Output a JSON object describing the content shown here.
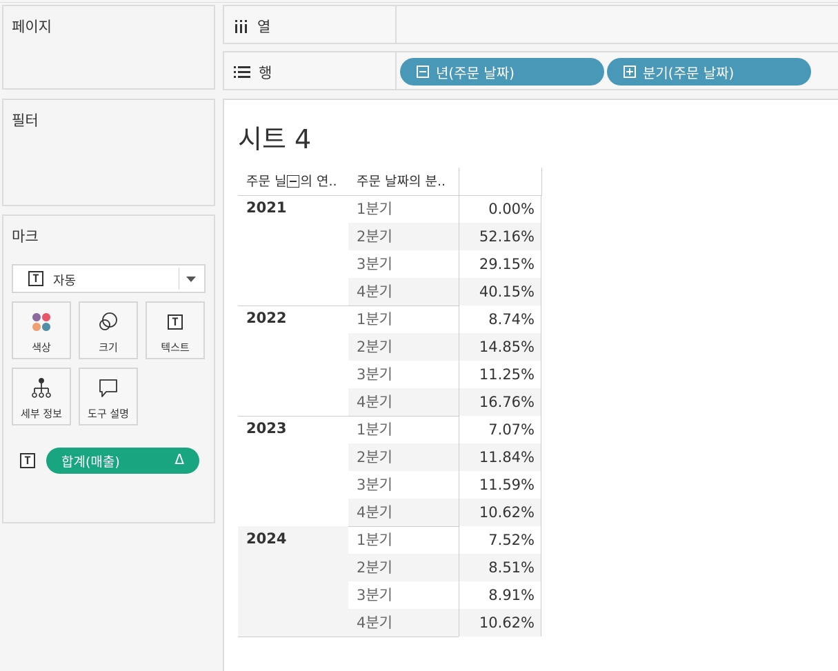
{
  "cards": {
    "pages_title": "페이지",
    "filters_title": "필터",
    "marks_title": "마크"
  },
  "marks": {
    "type_icon_letter": "T",
    "type_label": "자동",
    "buttons": {
      "color": "색상",
      "size": "크기",
      "text": "텍스트",
      "text_icon_letter": "T",
      "detail": "세부 정보",
      "tooltip": "도구 설명"
    },
    "field_icon_letter": "T",
    "field_pill": "합계(매출)",
    "field_pill_delta": "Δ",
    "pill_color": "#19a57f"
  },
  "shelves": {
    "columns_label": "열",
    "rows_label": "행",
    "row_pills": [
      "년(주문 날짜)",
      "분기(주문 날짜)"
    ],
    "pill_color": "#4a98b8"
  },
  "view": {
    "sheet_title": "시트 4",
    "headers": {
      "year": "주문 닐",
      "year_suffix": "의 연..",
      "quarter": "주문 날짜의 분.."
    },
    "rows": [
      {
        "year": "2021",
        "quarters": [
          {
            "q": "1분기",
            "v": "0.00%"
          },
          {
            "q": "2분기",
            "v": "52.16%"
          },
          {
            "q": "3분기",
            "v": "29.15%"
          },
          {
            "q": "4분기",
            "v": "40.15%"
          }
        ]
      },
      {
        "year": "2022",
        "quarters": [
          {
            "q": "1분기",
            "v": "8.74%"
          },
          {
            "q": "2분기",
            "v": "14.85%"
          },
          {
            "q": "3분기",
            "v": "11.25%"
          },
          {
            "q": "4분기",
            "v": "16.76%"
          }
        ]
      },
      {
        "year": "2023",
        "quarters": [
          {
            "q": "1분기",
            "v": "7.07%"
          },
          {
            "q": "2분기",
            "v": "11.84%"
          },
          {
            "q": "3분기",
            "v": "11.59%"
          },
          {
            "q": "4분기",
            "v": "10.62%"
          }
        ]
      },
      {
        "year": "2024",
        "quarters": [
          {
            "q": "1분기",
            "v": "7.52%"
          },
          {
            "q": "2분기",
            "v": "8.51%"
          },
          {
            "q": "3분기",
            "v": "8.91%"
          },
          {
            "q": "4분기",
            "v": "10.62%"
          }
        ]
      }
    ]
  }
}
